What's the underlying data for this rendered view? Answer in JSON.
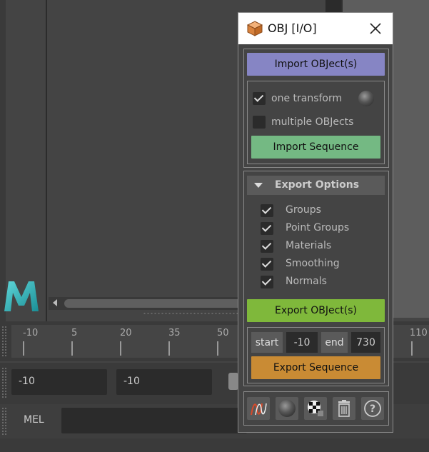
{
  "window": {
    "title": "OBJ [I/O]"
  },
  "import_section": {
    "import_button": "Import OBJect(s)",
    "one_transform_label": "one transform",
    "one_transform_checked": true,
    "multiple_objects_label": "multiple OBJects",
    "multiple_objects_checked": false,
    "import_sequence_button": "Import Sequence"
  },
  "export_options": {
    "header": "Export Options",
    "items": [
      {
        "label": "Groups",
        "checked": true
      },
      {
        "label": "Point Groups",
        "checked": true
      },
      {
        "label": "Materials",
        "checked": true
      },
      {
        "label": "Smoothing",
        "checked": true
      },
      {
        "label": "Normals",
        "checked": true
      }
    ],
    "export_button": "Export OBJect(s)"
  },
  "sequence": {
    "start_label": "start",
    "start_value": "-10",
    "end_label": "end",
    "end_value": "730",
    "export_sequence_button": "Export Sequence"
  },
  "toolbar": {
    "icons": [
      "curve-icon",
      "sphere-icon",
      "checker-shader-icon",
      "trash-icon",
      "help-icon"
    ]
  },
  "timeline": {
    "ticks": [
      "-10",
      "5",
      "20",
      "35",
      "50",
      "110"
    ]
  },
  "range": {
    "start_value": "-10",
    "playback_start": "-10"
  },
  "command_line": {
    "label": "MEL"
  },
  "colors": {
    "import_button": "#8685c4",
    "import_sequence_button": "#74b983",
    "export_button": "#7fb83b",
    "export_sequence_button": "#c98b34",
    "maya_logo": "#2ab3b8"
  }
}
